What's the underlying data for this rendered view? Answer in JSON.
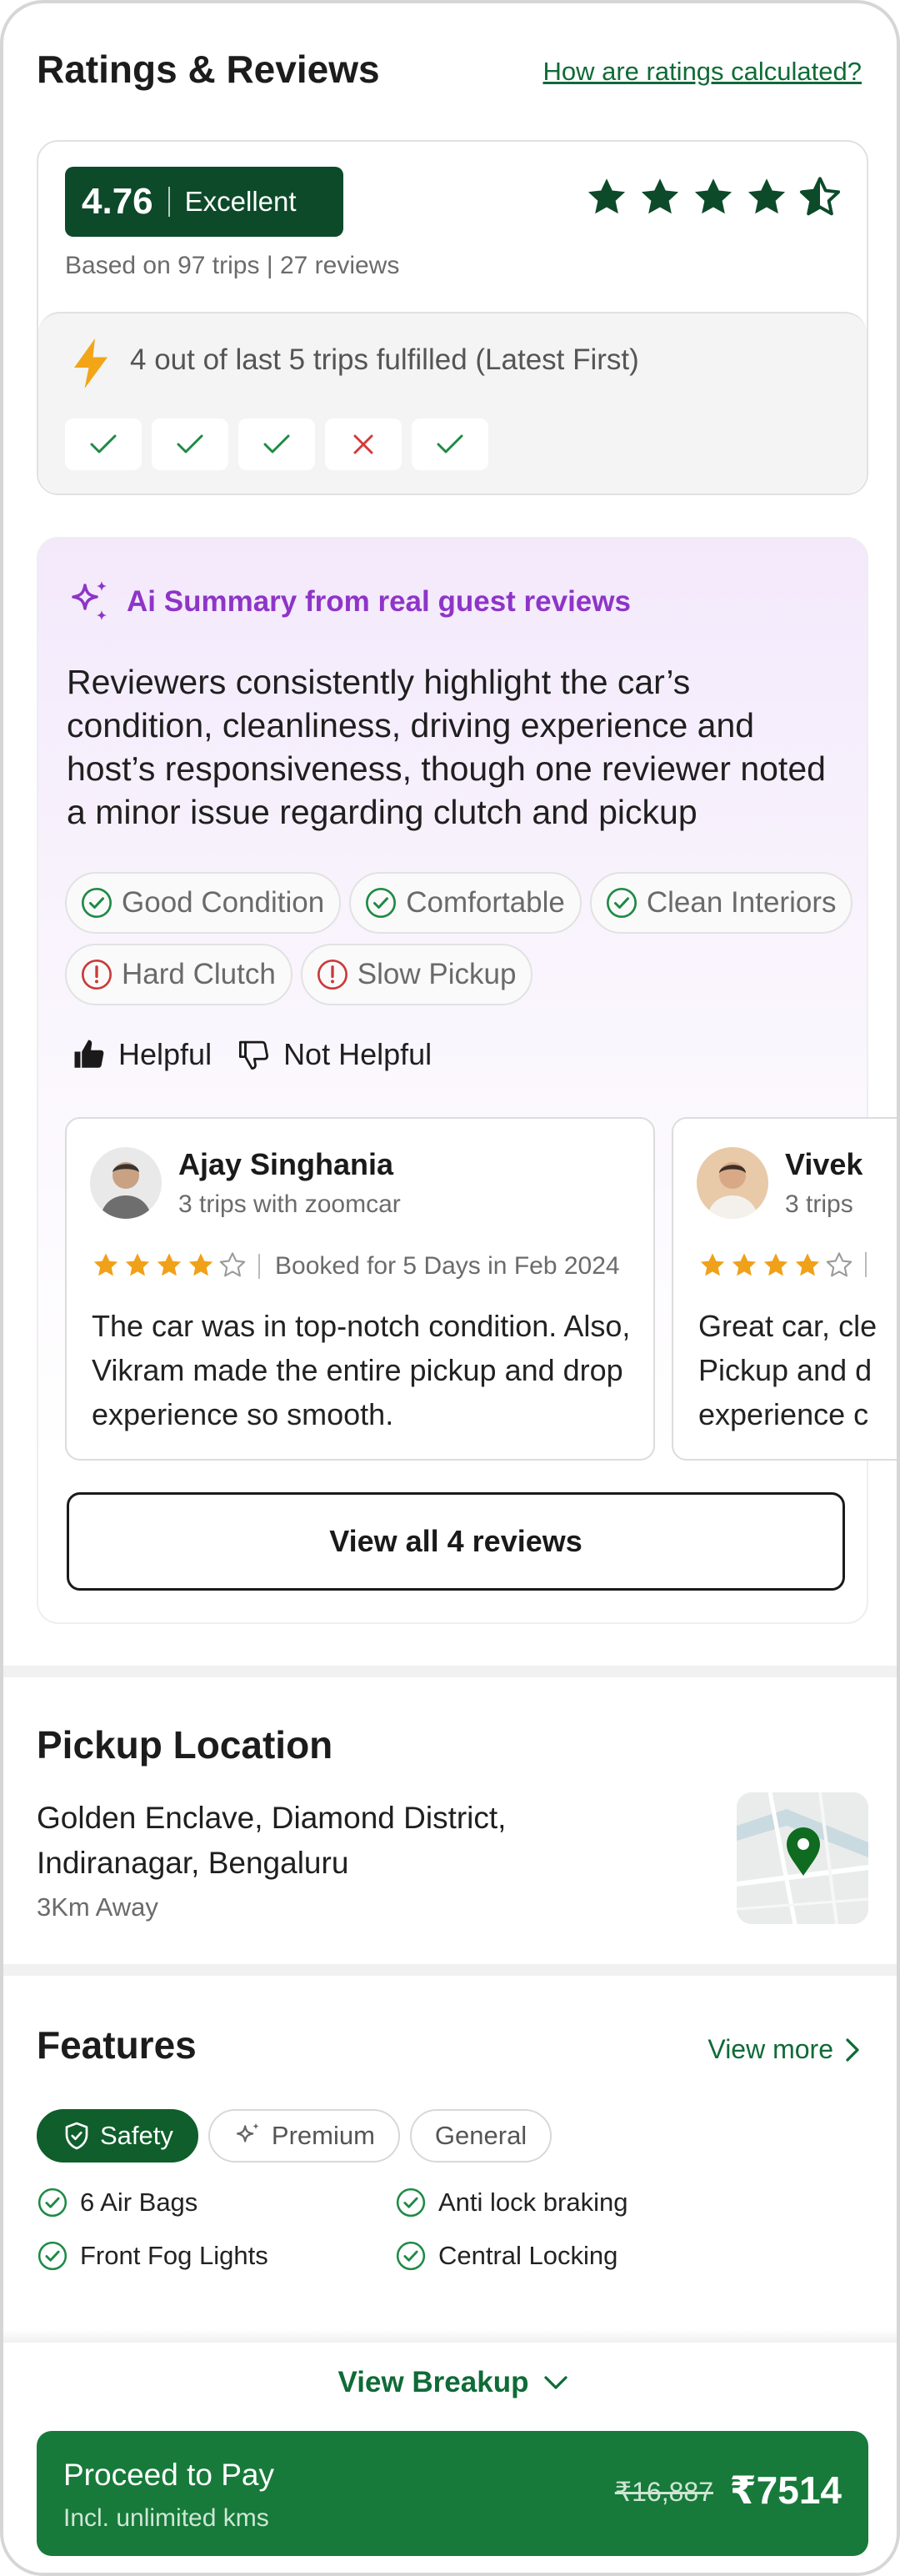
{
  "ratings": {
    "title": "Ratings & Reviews",
    "calc_link": "How are ratings calculated?",
    "score": "4.76",
    "score_label": "Excellent",
    "stars": 4.76,
    "based_on": "Based on 97 trips | 27 reviews",
    "fulfilment_text": "4 out of last 5 trips fulfilled (Latest First)",
    "trips": [
      "fulfilled",
      "fulfilled",
      "fulfilled",
      "cancelled",
      "fulfilled"
    ],
    "colors": {
      "badge": "#0d4a2a",
      "star": "#0d4a2a",
      "bolt": "#f2a516"
    }
  },
  "ai_summary": {
    "heading": "Ai Summary from real guest reviews",
    "text": "Reviewers consistently highlight the car’s condition, cleanliness, driving experience and host’s responsiveness, though one reviewer noted a minor issue regarding clutch and pickup",
    "chips": [
      {
        "label": "Good Condition",
        "kind": "positive"
      },
      {
        "label": "Comfortable",
        "kind": "positive"
      },
      {
        "label": "Clean Interiors",
        "kind": "positive"
      },
      {
        "label": "Hard Clutch",
        "kind": "negative"
      },
      {
        "label": "Slow Pickup",
        "kind": "negative"
      }
    ],
    "helpful": "Helpful",
    "not_helpful": "Not Helpful",
    "accent": "#8e35c8"
  },
  "reviews": [
    {
      "name": "Ajay Singhania",
      "trips": "3 trips with zoomcar",
      "rating": 4,
      "booked": "Booked for 5 Days in Feb 2024",
      "text": "The car was in top-notch condition. Also, Vikram made the entire pickup and drop experience so smooth."
    },
    {
      "name": "Vivek",
      "trips": "3 trips",
      "rating": 4,
      "booked": "",
      "text": "Great car, cle Pickup and d experience c"
    }
  ],
  "view_all": "View all 4 reviews",
  "pickup": {
    "title": "Pickup Location",
    "address": "Golden Enclave, Diamond District, Indiranagar, Bengaluru",
    "distance": "3Km Away"
  },
  "features": {
    "title": "Features",
    "view_more": "View more",
    "tabs": [
      {
        "label": "Safety",
        "active": true,
        "icon": "shield-icon"
      },
      {
        "label": "Premium",
        "active": false,
        "icon": "sparkle-icon"
      },
      {
        "label": "General",
        "active": false,
        "icon": ""
      }
    ],
    "items": [
      "6 Air Bags",
      "Anti lock braking",
      "Front Fog Lights",
      "Central Locking"
    ]
  },
  "footer": {
    "view_breakup": "View Breakup",
    "proceed": "Proceed to Pay",
    "sub": "Incl. unlimited kms",
    "old_price": "₹16,887",
    "price": "₹7514",
    "button_color": "#177a3a"
  }
}
